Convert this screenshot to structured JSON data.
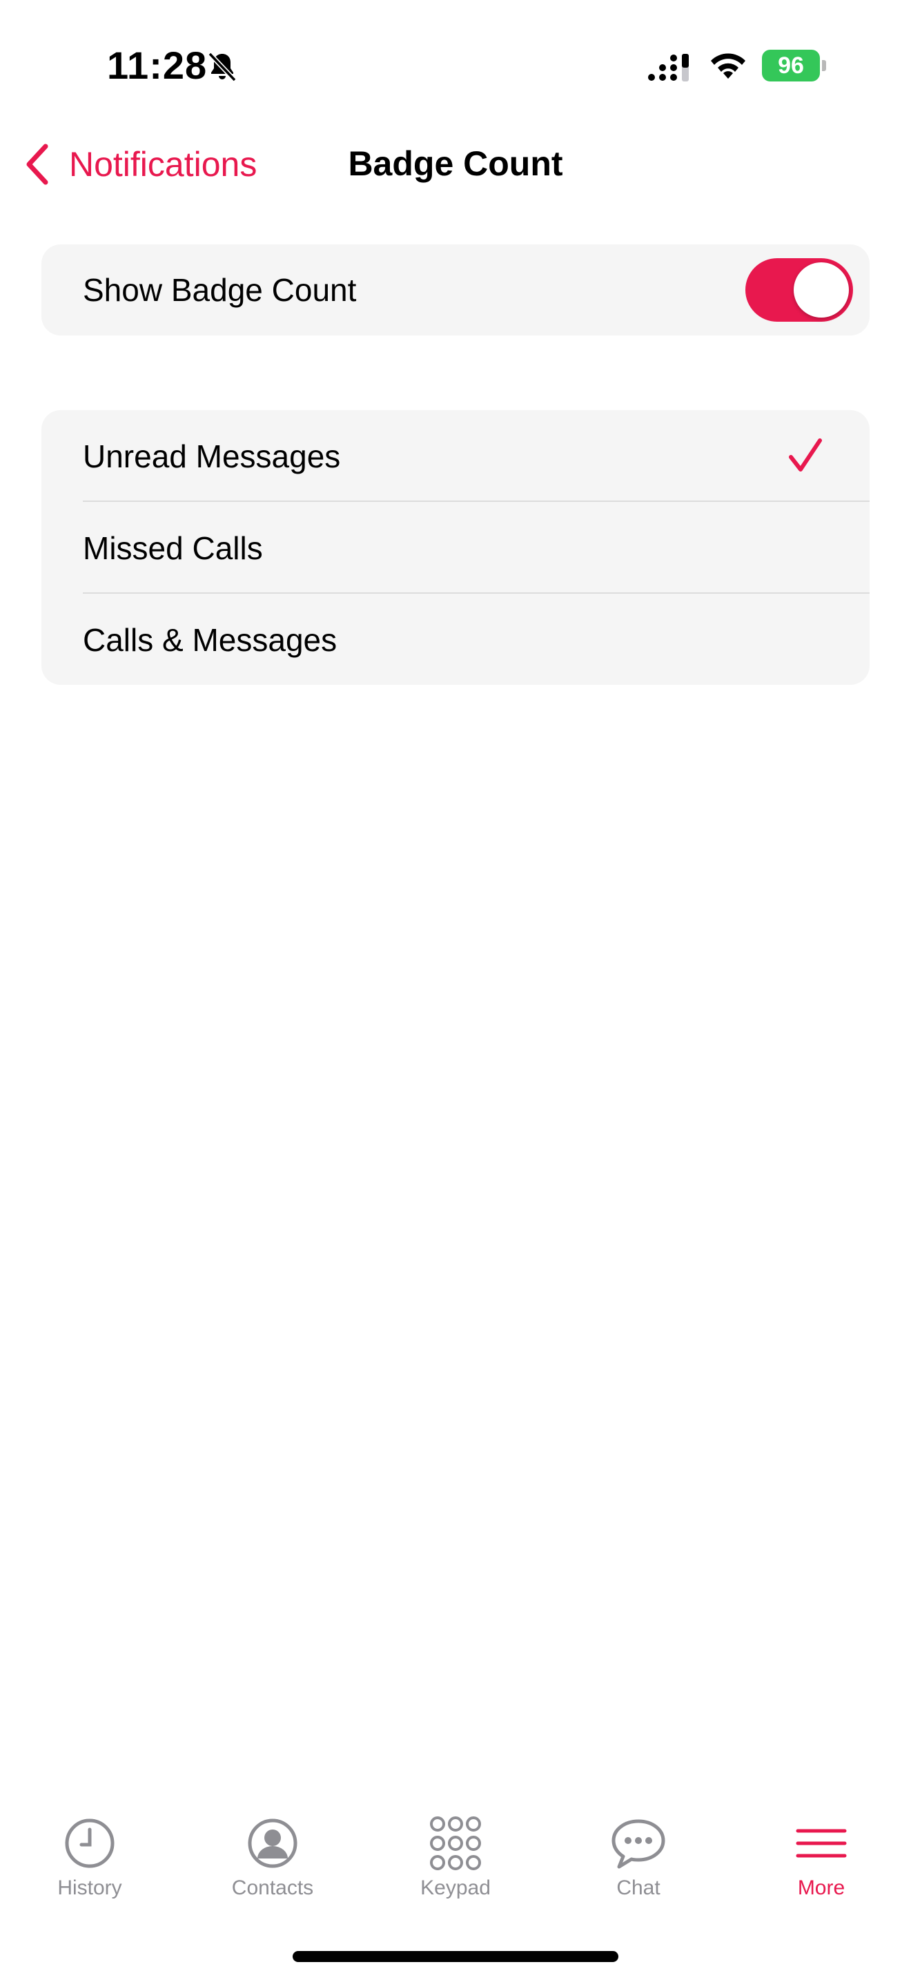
{
  "status_bar": {
    "time": "11:28",
    "battery_level": "96",
    "battery_color": "#34c759"
  },
  "nav": {
    "back_label": "Notifications",
    "title": "Badge Count"
  },
  "settings": {
    "show_badge_count_label": "Show Badge Count",
    "show_badge_count_enabled": true
  },
  "options": [
    {
      "label": "Unread Messages",
      "selected": true
    },
    {
      "label": "Missed Calls",
      "selected": false
    },
    {
      "label": "Calls & Messages",
      "selected": false
    }
  ],
  "tab_bar": {
    "tabs": [
      {
        "label": "History",
        "icon": "clock-icon",
        "active": false
      },
      {
        "label": "Contacts",
        "icon": "person-icon",
        "active": false
      },
      {
        "label": "Keypad",
        "icon": "keypad-icon",
        "active": false
      },
      {
        "label": "Chat",
        "icon": "chat-bubble-icon",
        "active": false
      },
      {
        "label": "More",
        "icon": "menu-icon",
        "active": true
      }
    ]
  },
  "colors": {
    "accent": "#e8184e",
    "inactive": "#8e8e93",
    "group_background": "#f5f5f5"
  }
}
